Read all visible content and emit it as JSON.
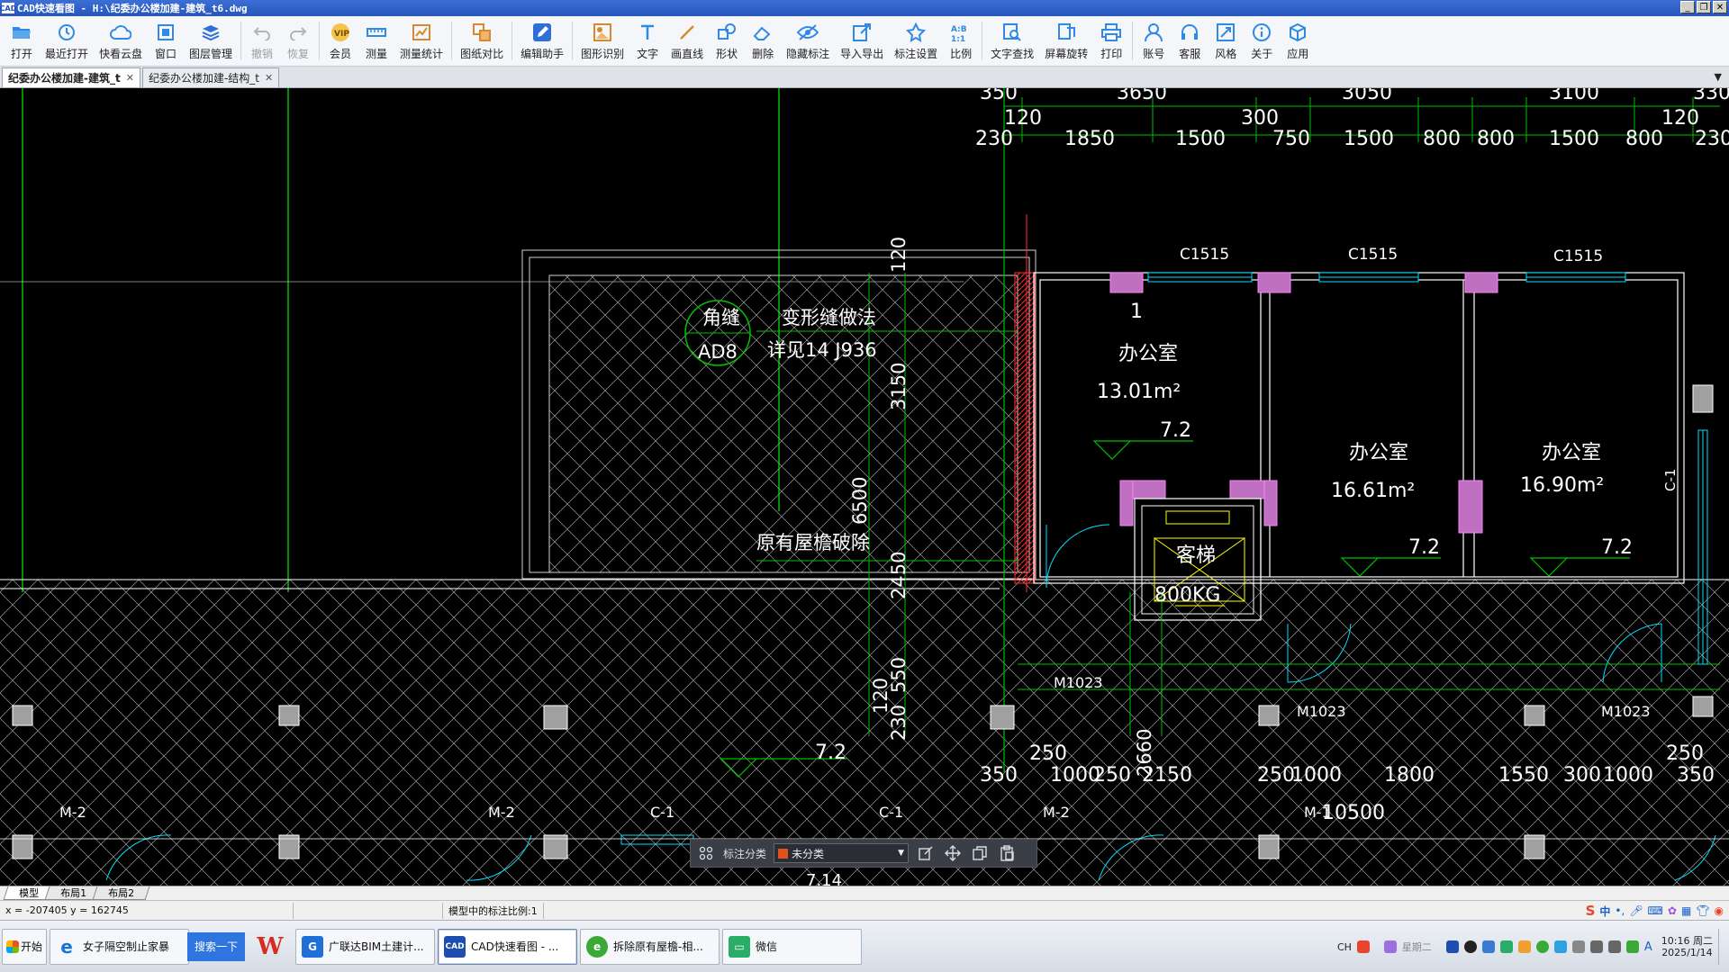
{
  "window": {
    "title": "CAD快速看图 - H:\\纪委办公楼加建-建筑_t6.dwg",
    "app_icon_text": "CAD"
  },
  "toolbar": [
    {
      "id": "open",
      "label": "打开",
      "icon": "open-folder-icon"
    },
    {
      "id": "recent",
      "label": "最近打开",
      "icon": "recent-clock-icon"
    },
    {
      "id": "cloud",
      "label": "快看云盘",
      "icon": "cloud-icon"
    },
    {
      "id": "window",
      "label": "窗口",
      "icon": "window-icon"
    },
    {
      "id": "layers",
      "label": "图层管理",
      "icon": "layers-icon"
    },
    {
      "id": "undo",
      "label": "撤销",
      "icon": "undo-icon",
      "disabled": true
    },
    {
      "id": "redo",
      "label": "恢复",
      "icon": "redo-icon",
      "disabled": true
    },
    {
      "id": "vip",
      "label": "会员",
      "icon": "vip-icon"
    },
    {
      "id": "measure",
      "label": "测量",
      "icon": "ruler-icon"
    },
    {
      "id": "measure_stats",
      "label": "测量统计",
      "icon": "measure-stats-icon"
    },
    {
      "id": "compare",
      "label": "图纸对比",
      "icon": "compare-icon"
    },
    {
      "id": "edit_assist",
      "label": "编辑助手",
      "icon": "edit-assist-icon"
    },
    {
      "id": "shape_recog",
      "label": "图形识别",
      "icon": "shape-recognize-icon"
    },
    {
      "id": "text",
      "label": "文字",
      "icon": "text-t-icon"
    },
    {
      "id": "line",
      "label": "画直线",
      "icon": "line-icon"
    },
    {
      "id": "shape",
      "label": "形状",
      "icon": "shape-icon"
    },
    {
      "id": "delete",
      "label": "删除",
      "icon": "eraser-icon"
    },
    {
      "id": "hide_anno",
      "label": "隐藏标注",
      "icon": "eye-hide-icon"
    },
    {
      "id": "import_export",
      "label": "导入导出",
      "icon": "import-export-icon"
    },
    {
      "id": "anno_settings",
      "label": "标注设置",
      "icon": "anno-settings-icon"
    },
    {
      "id": "scale",
      "label": "比例",
      "icon": "scale-ratio-icon"
    },
    {
      "id": "text_search",
      "label": "文字查找",
      "icon": "text-search-icon"
    },
    {
      "id": "rotate",
      "label": "屏幕旋转",
      "icon": "screen-rotate-icon"
    },
    {
      "id": "print",
      "label": "打印",
      "icon": "printer-icon"
    },
    {
      "id": "account",
      "label": "账号",
      "icon": "user-icon"
    },
    {
      "id": "service",
      "label": "客服",
      "icon": "headset-icon"
    },
    {
      "id": "style",
      "label": "风格",
      "icon": "style-icon"
    },
    {
      "id": "about",
      "label": "关于",
      "icon": "info-icon"
    },
    {
      "id": "apps",
      "label": "应用",
      "icon": "cube-icon"
    }
  ],
  "doc_tabs": [
    {
      "label": "纪委办公楼加建-建筑_t",
      "active": true
    },
    {
      "label": "纪委办公楼加建-结构_t",
      "active": false
    }
  ],
  "drawing": {
    "dims_top_row1": [
      "350",
      "3650",
      "3050",
      "3100",
      "330"
    ],
    "dims_top_row2": [
      "120",
      "300",
      "120"
    ],
    "dims_top_row3": [
      "230",
      "1850",
      "1500",
      "750",
      "1500",
      "800",
      "800",
      "1500",
      "800",
      "230"
    ],
    "windows_top": [
      "C1515",
      "C1515",
      "C1515"
    ],
    "joint_tag_top": "角缝",
    "joint_tag_bottom": "AD8",
    "joint_note_1": "变形缝做法",
    "joint_note_2": "详见14 J936",
    "demolish_note": "原有屋檐破除",
    "dim_vertical_left": [
      "120",
      "3150",
      "6500",
      "2450",
      "550",
      "120",
      "230"
    ],
    "room1_name": "办公室",
    "room1_area": "13.01m²",
    "room1_elev": "7.2",
    "room2_name": "办公室",
    "room2_area": "16.61m²",
    "room2_elev": "7.2",
    "room3_name": "办公室",
    "room3_area": "16.90m²",
    "room3_elev": "7.2",
    "index_mark": "1",
    "elevator_name": "客梯",
    "elevator_load": "800KG",
    "doors": [
      "M1023",
      "M1023",
      "M1023"
    ],
    "window_side": "C-1",
    "dims_bottom_row1": [
      "250",
      "250"
    ],
    "dims_bottom_row2": [
      "350",
      "1000",
      "250",
      "2150",
      "250",
      "1000",
      "1800",
      "1550",
      "300",
      "1000",
      "350"
    ],
    "dim_2660": "2660",
    "dim_total": "10500",
    "lower_elev": "7.2",
    "lower_labels": [
      "M-2",
      "M-2",
      "C-1",
      "C-1",
      "M-2",
      "M-1"
    ],
    "partial_bottom": "7.14"
  },
  "floatbar": {
    "label": "标注分类",
    "selected": "未分类",
    "category_color": "#e0531f"
  },
  "layout_tabs": [
    "模型",
    "布局1",
    "布局2"
  ],
  "status": {
    "coords": "x = -207405  y = 162745",
    "scale_text": "模型中的标注比例:1",
    "ime": "中"
  },
  "taskbar": {
    "start": "开始",
    "tasks": [
      {
        "label": "女子隔空制止家暴",
        "icon": "browser-ie-icon",
        "color": "#1a73d9"
      },
      {
        "label": "广联达BIM土建计...",
        "icon": "glodon-icon",
        "color": "#1e6fd8"
      },
      {
        "label": "CAD快速看图 - ...",
        "icon": "cad-icon",
        "color": "#1e4fb0",
        "active": true
      },
      {
        "label": "拆除原有屋檐-相...",
        "icon": "browser-360-icon",
        "color": "#3aa935"
      },
      {
        "label": "微信",
        "icon": "wechat-icon",
        "color": "#2aae67"
      }
    ],
    "search_btn": "搜索一下",
    "tray_lang": "CH",
    "weekday_widget": "星期二",
    "clock_time": "10:16 周二",
    "clock_date": "2025/1/14"
  }
}
